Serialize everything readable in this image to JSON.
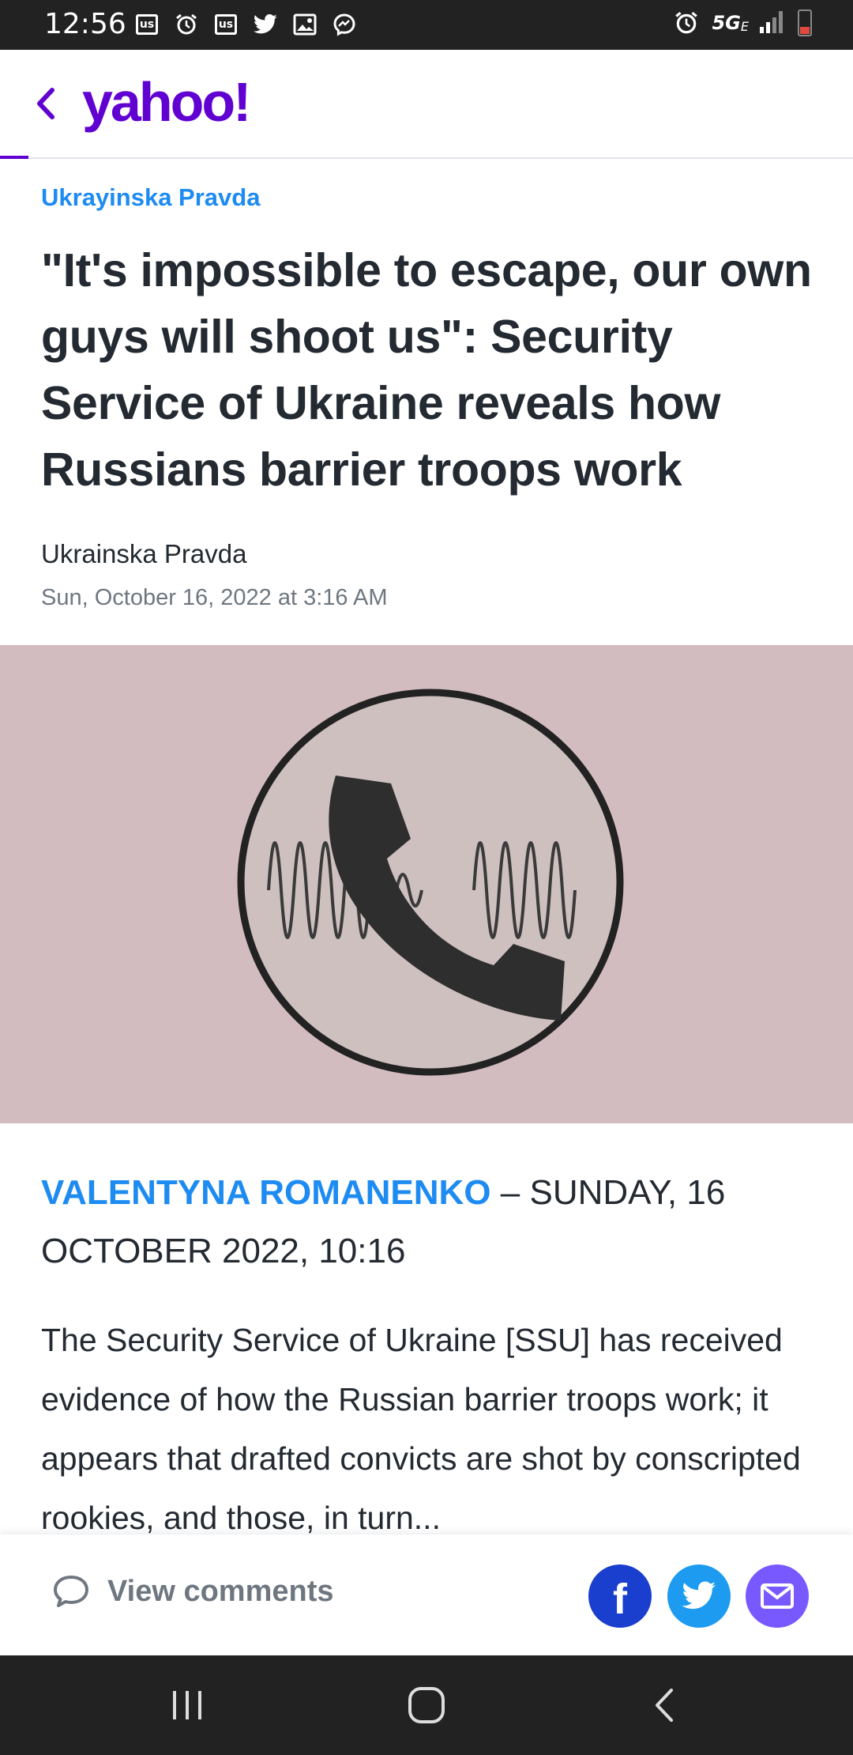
{
  "status_bar": {
    "time": "12:56",
    "left_icons": [
      "us-app-icon",
      "alarm-icon",
      "us-app-icon",
      "twitter-icon",
      "gallery-icon",
      "messenger-icon"
    ],
    "us_label": "us",
    "network": "5G",
    "network_sub": "E"
  },
  "header": {
    "logo_text": "yahoo!",
    "logo_color": "#6001d2"
  },
  "article": {
    "provider": "Ukrayinska Pravda",
    "headline": "\"It's impossible to escape, our own guys will shoot us\": Security Service of Ukraine reveals how Russians barrier troops work",
    "source": "Ukrainska Pravda",
    "published": "Sun, October 16, 2022 at 3:16 AM",
    "author": "VALENTYNA ROMANENKO",
    "dateline": " – SUNDAY, 16 OCTOBER 2022, 10:16",
    "first_paragraph": "The Security Service of Ukraine [SSU] has received evidence of how the Russian barrier troops work; it appears that drafted convicts are shot by conscripted rookies, and those, in turn..."
  },
  "actions": {
    "comments_label": "View comments",
    "share": [
      "facebook",
      "twitter",
      "email"
    ],
    "facebook_glyph": "f"
  },
  "colors": {
    "accent": "#6001d2",
    "link": "#1d8bf1",
    "image_bg": "#d3bcbf",
    "facebook": "#1a3ecd",
    "twitter": "#1d9bf0",
    "email": "#7759ff"
  }
}
